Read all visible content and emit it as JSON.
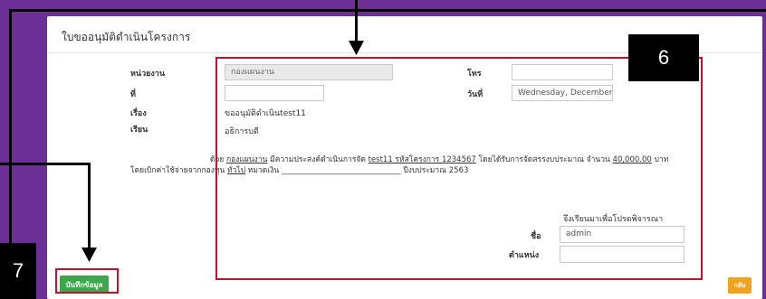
{
  "form": {
    "title": "ใบขออนุมัติดำเนินโครงการ",
    "fields": {
      "department_label": "หน่วยงาน",
      "department_value": "กองแผนงาน",
      "phone_label": "โทร",
      "phone_value": "",
      "number_label": "ที่",
      "number_value": "",
      "date_label": "วันที่",
      "date_value": "Wednesday, December",
      "subject_label": "เรื่อง",
      "subject_value": "ขออนุมัติดำเนินtest11",
      "to_label": "เรียน",
      "to_value": "อธิการบดี"
    },
    "paragraph": {
      "p1_prefix": "ด้วย",
      "p1_dept": "กองแผนงาน",
      "p1_mid": "มีความประสงค์ดำเนินการจัด",
      "p1_project": "test11 รหัสโครงการ 1234567",
      "p1_mid2": "โดยได้รับการจัดสรรงบประมาณ จำนวน",
      "p1_amount": "40,000.00",
      "p1_unit": "บาท",
      "p2_prefix": "โดยเบิกค่าใช้จ่ายจากกองทุน",
      "p2_fund": "ทั่วไป",
      "p2_mid": "หมวดเงิน _______________________________",
      "p2_year": "ปีงบประมาณ 2563"
    },
    "closing": "จึงเรียนมาเพื่อโปรดพิจารณา",
    "signature": {
      "name_label": "ชื่อ",
      "name_value": "admin",
      "position_label": "ตำแหน่ง",
      "position_value": ""
    },
    "save_button": "บันทึกข้อมูล",
    "back_button": "กลับ"
  },
  "annotations": {
    "box6_number": "6",
    "box7_number": "7"
  },
  "colors": {
    "background": "#6b2f96",
    "highlight": "#c8102e",
    "save": "#3aa84a",
    "back": "#f0a21f"
  }
}
